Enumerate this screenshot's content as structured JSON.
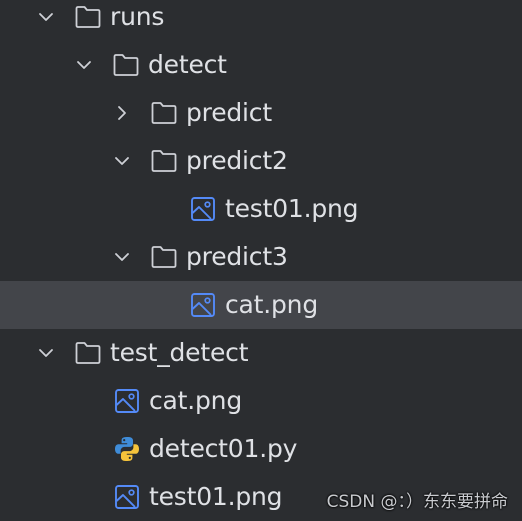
{
  "tree": {
    "items": [
      {
        "label": "runs",
        "icon": "folder-icon",
        "expanded": true
      },
      {
        "label": "detect",
        "icon": "folder-icon",
        "expanded": true
      },
      {
        "label": "predict",
        "icon": "folder-icon",
        "expanded": false
      },
      {
        "label": "predict2",
        "icon": "folder-icon",
        "expanded": true
      },
      {
        "label": "test01.png",
        "icon": "image-file-icon"
      },
      {
        "label": "predict3",
        "icon": "folder-icon",
        "expanded": true
      },
      {
        "label": "cat.png",
        "icon": "image-file-icon",
        "selected": true
      },
      {
        "label": "test_detect",
        "icon": "folder-icon",
        "expanded": true
      },
      {
        "label": "cat.png",
        "icon": "image-file-icon"
      },
      {
        "label": "detect01.py",
        "icon": "python-file-icon"
      },
      {
        "label": "test01.png",
        "icon": "image-file-icon"
      }
    ]
  },
  "watermark": {
    "text": "CSDN @：）东东要拼命"
  },
  "colors": {
    "background": "#2b2d30",
    "selection": "#43454a",
    "text": "#dfe1e5",
    "icon_outline": "#ced0d6",
    "image_icon_accent": "#548af7"
  }
}
